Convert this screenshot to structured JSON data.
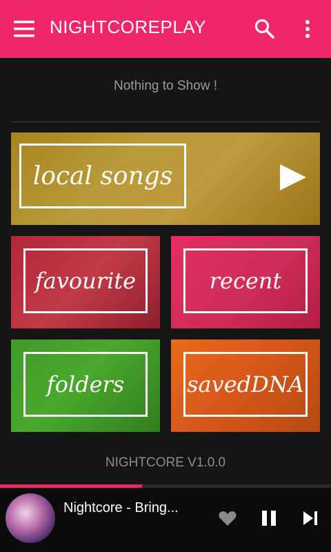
{
  "appbar": {
    "title": "NIGHTCOREPLAY",
    "icons": {
      "menu": "hamburger-menu-icon",
      "search": "search-icon",
      "more": "more-vert-icon"
    }
  },
  "library": {
    "empty_message": "Nothing to Show !"
  },
  "tiles": {
    "local_songs": "local songs",
    "favourite": "favourite",
    "recent": "recent",
    "folders": "folders",
    "saved_dna": "savedDNA"
  },
  "version": "NIGHTCORE V1.0.0",
  "player": {
    "track_title": "Nightcore - Bring...",
    "progress": 0.43
  },
  "colors": {
    "accent": "#f0266c",
    "background": "#151515"
  }
}
